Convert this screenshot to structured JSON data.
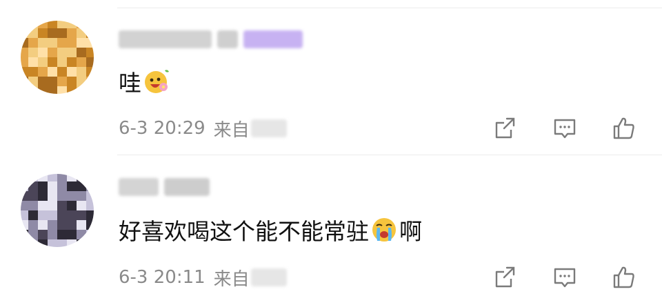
{
  "comments": [
    {
      "text": "哇",
      "emoji": "smiling-flower-emoji",
      "time": "6-3 20:29",
      "source_prefix": "来自",
      "avatar_colors": [
        "#e5a64a",
        "#c98524",
        "#f3cd80",
        "#a86b1f",
        "#ffe0a8"
      ]
    },
    {
      "text_before": "好喜欢喝这个能不能常驻",
      "emoji": "crying-emoji",
      "text_after": "啊",
      "time": "6-3 20:11",
      "source_prefix": "来自",
      "avatar_colors": [
        "#8f8aa6",
        "#4b4558",
        "#c6c2da",
        "#2d2a36",
        "#e8e6f2"
      ]
    }
  ],
  "actions": [
    "share-icon",
    "comment-icon",
    "like-icon"
  ],
  "colors": {
    "text": "#111111",
    "meta": "#8a8a8a",
    "icon": "#7a7a7a",
    "badge": "#b99cf0"
  }
}
